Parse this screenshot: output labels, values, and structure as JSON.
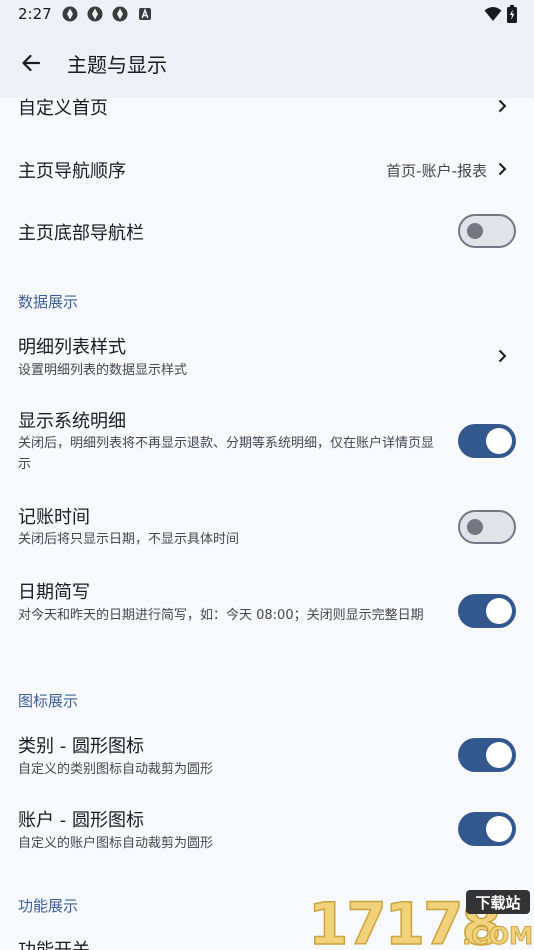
{
  "status_bar": {
    "time": "2:27"
  },
  "app_bar": {
    "title": "主题与显示"
  },
  "rows": {
    "custom_home": {
      "title": "自定义首页"
    },
    "nav_order": {
      "title": "主页导航顺序",
      "value": "首页-账户-报表"
    },
    "bottom_nav": {
      "title": "主页底部导航栏",
      "enabled": false
    }
  },
  "sections": {
    "data": "数据展示",
    "icon": "图标展示",
    "feature": "功能展示"
  },
  "data_rows": {
    "list_style": {
      "title": "明细列表样式",
      "subtitle": "设置明细列表的数据显示样式"
    },
    "system_detail": {
      "title": "显示系统明细",
      "subtitle": "关闭后，明细列表将不再显示退款、分期等系统明细，仅在账户详情页显示",
      "enabled": true
    },
    "record_time": {
      "title": "记账时间",
      "subtitle": "关闭后将只显示日期，不显示具体时间",
      "enabled": false
    },
    "date_short": {
      "title": "日期简写",
      "subtitle": "对今天和昨天的日期进行简写，如：今天 08:00；关闭则显示完整日期",
      "enabled": true
    }
  },
  "icon_rows": {
    "category_round": {
      "title": "类别 - 圆形图标",
      "subtitle": "自定义的类别图标自动裁剪为圆形",
      "enabled": true
    },
    "account_round": {
      "title": "账户 - 圆形图标",
      "subtitle": "自定义的账户图标自动裁剪为圆形",
      "enabled": true
    }
  },
  "feature_rows": {
    "feature_switch": {
      "title": "功能开关"
    }
  },
  "watermark": {
    "brand": "17178",
    "tag": "下载站",
    "domain": ".COM"
  },
  "colors": {
    "accent": "#33588e",
    "section": "#3b5f96",
    "background": "#f8f9fd"
  }
}
